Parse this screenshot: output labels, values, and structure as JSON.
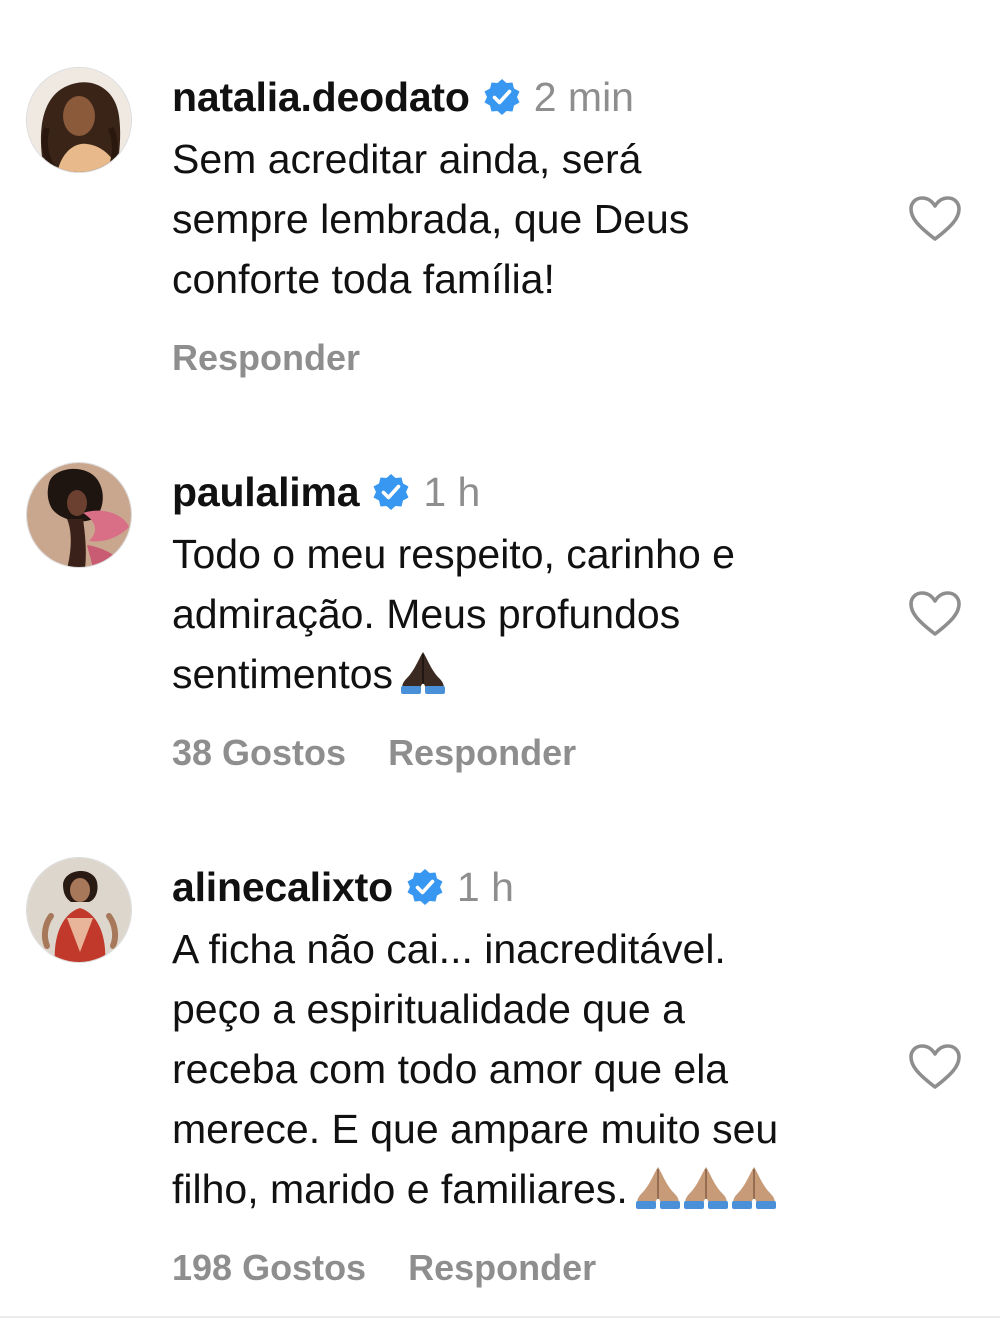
{
  "comments": [
    {
      "username": "natalia.deodato",
      "verified": true,
      "time": "2 min",
      "text_lines": [
        "Sem acreditar ainda, será",
        "sempre lembrada, que Deus",
        "conforte toda família!"
      ],
      "likes_label": "",
      "reply_label": "Responder",
      "avatar_icon": "profile-photo",
      "like_icon": "heart-outline-icon"
    },
    {
      "username": "paulalima",
      "verified": true,
      "time": "1 h",
      "text_lines": [
        "Todo o meu respeito, carinho e",
        "admiração. Meus profundos",
        "sentimentos"
      ],
      "emoji": "🙏🏿",
      "likes_label": "38 Gostos",
      "reply_label": "Responder",
      "avatar_icon": "profile-photo",
      "like_icon": "heart-outline-icon"
    },
    {
      "username": "alinecalixto",
      "verified": true,
      "time": "1 h",
      "text_lines": [
        "A ficha não cai... inacreditável.",
        "peço a espiritualidade que a",
        "receba com todo amor que ela",
        "merece. E que ampare muito seu",
        "filho, marido e familiares."
      ],
      "emoji": "🙏🏽🙏🏽🙏🏽",
      "likes_label": "198 Gostos",
      "reply_label": "Responder",
      "avatar_icon": "profile-photo",
      "like_icon": "heart-outline-icon"
    }
  ],
  "colors": {
    "text": "#111111",
    "secondary": "#8e8e8e",
    "verified_blue": "#3897f0",
    "heart_stroke": "#8e8e8e"
  }
}
